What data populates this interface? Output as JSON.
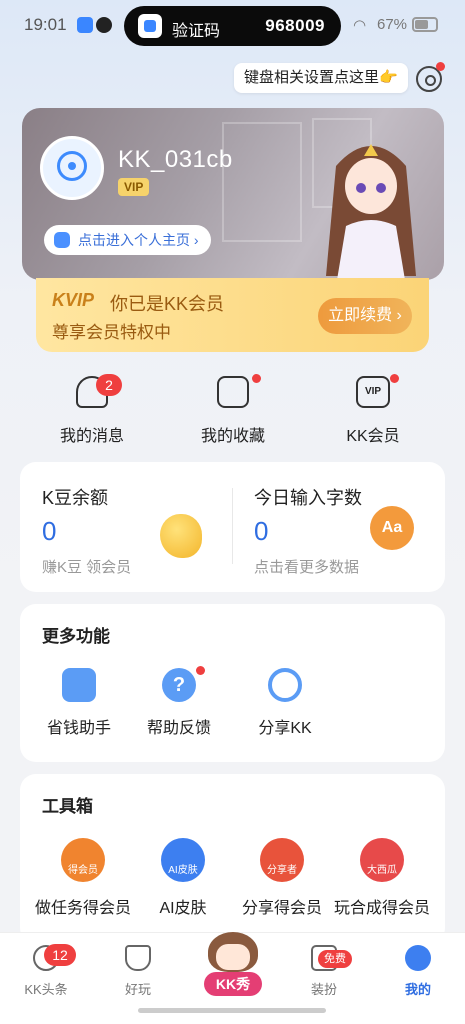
{
  "status_bar": {
    "time": "19:01",
    "notification_app": "验证码",
    "notification_code": "968009",
    "battery": "67%"
  },
  "keyboard_tip": "键盘相关设置点这里👉",
  "profile": {
    "username": "KK_031cb",
    "vip_label": "VIP",
    "home_link": "点击进入个人主页 ›"
  },
  "vip_banner": {
    "brand": "KVIP",
    "title": "你已是KK会员",
    "subtitle": "尊享会员特权中",
    "renew_button": "立即续费 ›"
  },
  "quick": [
    {
      "label": "我的消息",
      "badge": "2",
      "icon": "bell-icon"
    },
    {
      "label": "我的收藏",
      "icon": "folder-star-icon"
    },
    {
      "label": "KK会员",
      "icon": "vip-crown-icon",
      "icon_text": "VIP"
    }
  ],
  "stats": {
    "kdou": {
      "title": "K豆余额",
      "value": "0",
      "sub": "赚K豆 领会员"
    },
    "input": {
      "title": "今日输入字数",
      "value": "0",
      "sub": "点击看更多数据",
      "icon_text": "Aa"
    }
  },
  "more": {
    "title": "更多功能",
    "items": [
      {
        "label": "省钱助手",
        "icon": "saving-icon"
      },
      {
        "label": "帮助反馈",
        "icon": "help-icon",
        "glyph": "?"
      },
      {
        "label": "分享KK",
        "icon": "share-icon"
      }
    ]
  },
  "toolbox": {
    "title": "工具箱",
    "items": [
      {
        "label": "做任务得会员",
        "icon": "task-vip-icon",
        "tag": "得会员"
      },
      {
        "label": "AI皮肤",
        "icon": "ai-skin-icon",
        "tag": "AI皮肤"
      },
      {
        "label": "分享得会员",
        "icon": "share-vip-icon",
        "tag": "分享者"
      },
      {
        "label": "玩合成得会员",
        "icon": "merge-game-icon",
        "tag": "大西瓜"
      }
    ]
  },
  "tabbar": {
    "items": [
      {
        "label": "KK头条",
        "badge": "12"
      },
      {
        "label": "好玩"
      },
      {
        "label": "KK秀"
      },
      {
        "label": "装扮",
        "badge": "免费"
      },
      {
        "label": "我的"
      }
    ]
  },
  "colors": {
    "accent": "#2f6de1",
    "badge": "#ef3f3f",
    "vip_gold": "#fbd477"
  }
}
